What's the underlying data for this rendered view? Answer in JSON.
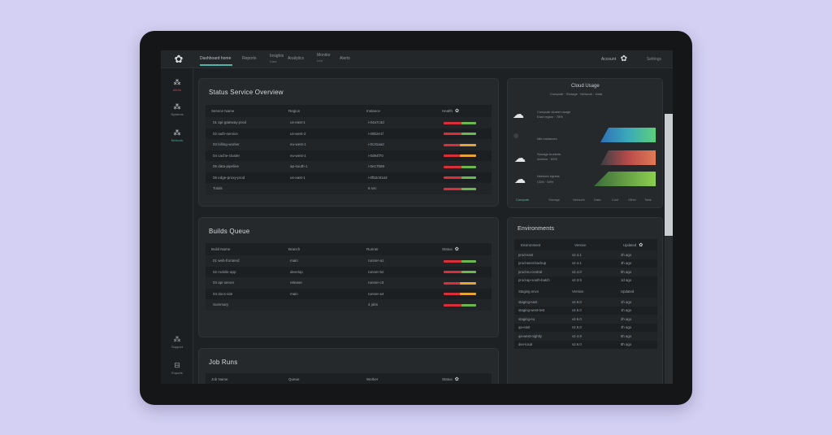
{
  "topbar": {
    "nav": [
      {
        "label": "Dashboard home",
        "sub": ""
      },
      {
        "label": "Reports",
        "sub": ""
      },
      {
        "label": "Insights",
        "sub": "Data"
      },
      {
        "label": "Analytics",
        "sub": ""
      },
      {
        "label": "Monitor",
        "sub": "Live"
      },
      {
        "label": "Alerts",
        "sub": ""
      }
    ],
    "user_name": "Account",
    "user_meta": "Settings"
  },
  "sidebar": {
    "items": [
      {
        "label": "Alerts"
      },
      {
        "label": "Systems"
      },
      {
        "label": "Network"
      }
    ],
    "bottom": [
      {
        "label": "Support"
      },
      {
        "label": "Exports"
      }
    ]
  },
  "panel1": {
    "title": "Status Service Overview",
    "headers": [
      "Service Name",
      "Region",
      "Instance",
      "Health"
    ],
    "rows": [
      [
        "01 api-gateway-prod",
        "us-east-1",
        "i-04a7c3d",
        "bar-g"
      ],
      [
        "02 auth-service",
        "us-west-2",
        "i-09b2e1f",
        "bar-g"
      ],
      [
        "03 billing-worker",
        "eu-west-1",
        "i-0c31aa2",
        "bar-o"
      ],
      [
        "04 cache-cluster",
        "eu-west-1",
        "i-0d94f70",
        "bar-o"
      ],
      [
        "05 data-pipeline",
        "ap-south-1",
        "i-0e17b88",
        "bar-g"
      ],
      [
        "06 edge-proxy-prod",
        "us-east-1",
        "i-0f52c91a3",
        "bar-g"
      ],
      [
        "Totals",
        "",
        "6 svc",
        "bar-g"
      ]
    ]
  },
  "panel2": {
    "title": "Builds Queue",
    "headers": [
      "Build Name",
      "Branch",
      "Runner",
      "Status"
    ],
    "rows": [
      [
        "01 web-frontend",
        "main",
        "runner-a1",
        "bar-g"
      ],
      [
        "02 mobile-app",
        "develop",
        "runner-b2",
        "bar-g"
      ],
      [
        "03 api-server",
        "release",
        "runner-c3",
        "bar-o"
      ],
      [
        "04 docs-site",
        "main",
        "runner-a4",
        "bar-o"
      ],
      [
        "Summary",
        "",
        "4 jobs",
        "bar-g"
      ]
    ]
  },
  "panel3": {
    "title": "Job Runs",
    "headers": [
      "Job Name",
      "Queue",
      "Worker",
      "Status"
    ]
  },
  "rightcard": {
    "title": "Cloud Usage",
    "subtitle": "Compute · Storage · Network · Data",
    "rows": [
      {
        "line1": "Compute cluster usage",
        "line2": "East region · 78%"
      },
      {
        "line1": "Idle instances",
        "line2": ""
      },
      {
        "line1": "Storage buckets",
        "line2": "Archive · 62%"
      },
      {
        "line1": "Network egress",
        "line2": "CDN · 54%"
      }
    ],
    "axis": [
      "Compute",
      "Storage",
      "Network",
      "Data",
      "Cost",
      "Other",
      "Total"
    ]
  },
  "rightpanel": {
    "title": "Environments",
    "headers": [
      "Environment",
      "Version",
      "Updated"
    ],
    "group1": [
      [
        "prod-east",
        "v2.4.1",
        "2h ago"
      ],
      [
        "prod-west-backup",
        "v2.4.1",
        "3h ago"
      ],
      [
        "prod-eu-central",
        "v2.4.0",
        "5h ago"
      ],
      [
        "prod-ap-south-batch",
        "v2.3.9",
        "1d ago"
      ]
    ],
    "group_header": [
      "Staging envs",
      "Version",
      "Updated"
    ],
    "group2": [
      [
        "staging-east",
        "v2.5.0",
        "1h ago"
      ],
      [
        "staging-west-test",
        "v2.5.0",
        "1h ago"
      ],
      [
        "staging-eu",
        "v2.5.0",
        "2h ago"
      ],
      [
        "qa-east",
        "v2.5.0",
        "4h ago"
      ],
      [
        "qa-west-nightly",
        "v2.4.9",
        "6h ago"
      ],
      [
        "dev-local",
        "v2.6.0",
        "8h ago"
      ]
    ]
  }
}
